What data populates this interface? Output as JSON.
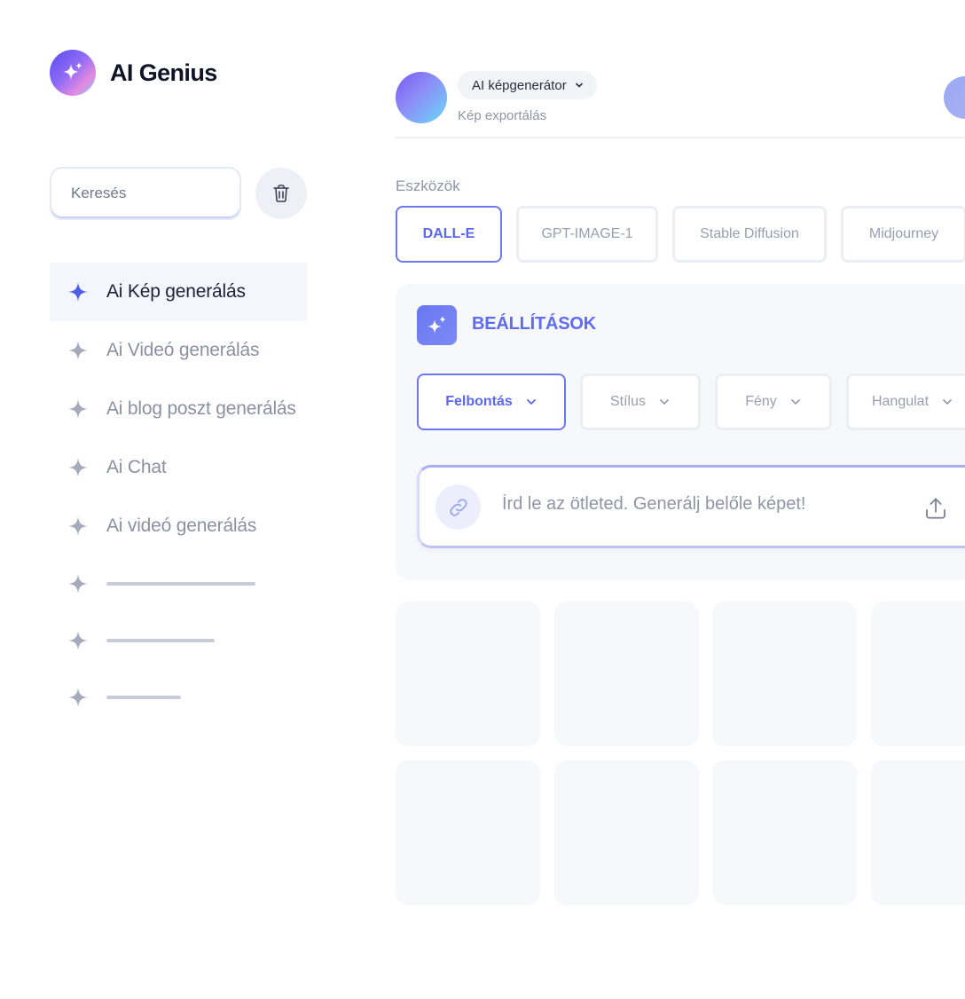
{
  "brand": {
    "name": "AI Genius"
  },
  "search": {
    "placeholder": "Keresés"
  },
  "sidebar": {
    "items": [
      {
        "label": "Ai Kép generálás"
      },
      {
        "label": "Ai Videó generálás"
      },
      {
        "label": "Ai blog poszt generálás"
      },
      {
        "label": "Ai Chat"
      },
      {
        "label": "Ai videó generálás"
      }
    ]
  },
  "header": {
    "select_label": "AI képgenerátor",
    "sub_link": "Kép exportálás"
  },
  "tools": {
    "label": "Eszközök",
    "items": [
      "DALL-E",
      "GPT-IMAGE-1",
      "Stable Diffusion",
      "Midjourney"
    ]
  },
  "settings": {
    "title": "BEÁLLÍTÁSOK",
    "dropdowns": [
      "Felbontás",
      "Stílus",
      "Fény",
      "Hangulat"
    ]
  },
  "prompt": {
    "placeholder": "Írd le az ötleted. Generálj belőle képet!"
  },
  "colors": {
    "accent": "#6d78f0",
    "active_nav_bg": "#f3f6fd",
    "panel_bg": "#f7f8fb"
  }
}
